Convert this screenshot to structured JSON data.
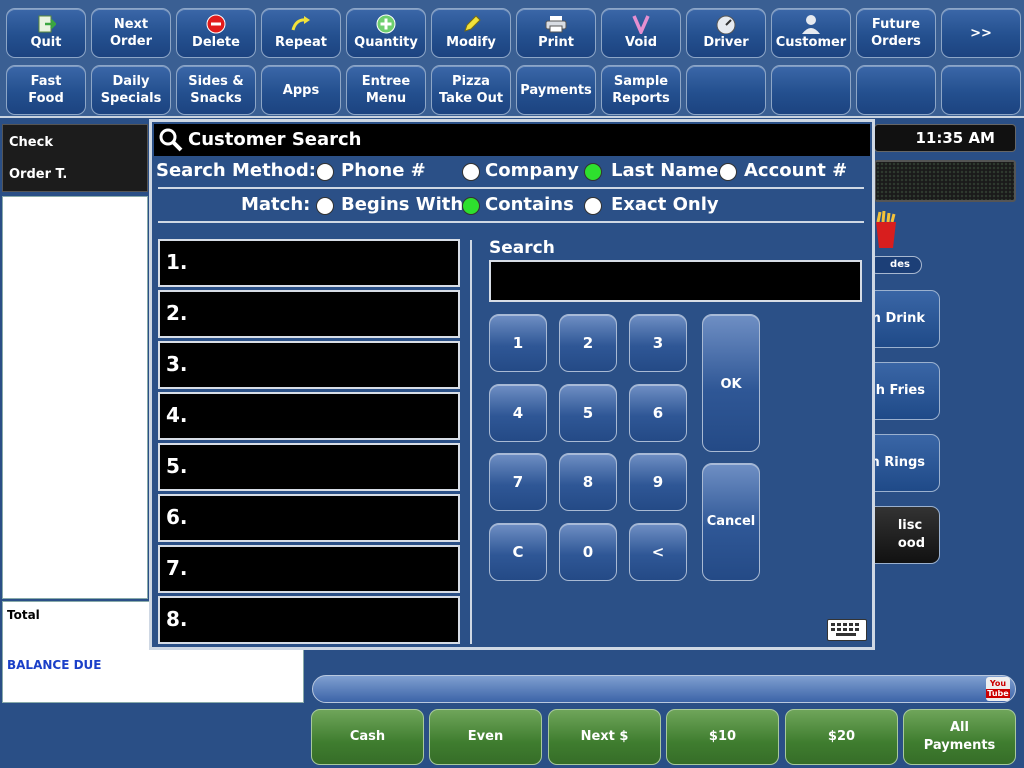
{
  "toolbar": {
    "row1": [
      {
        "label": "Quit",
        "icon": "quit-icon"
      },
      {
        "label": "Next\nOrder",
        "icon": ""
      },
      {
        "label": "Delete",
        "icon": "delete-icon"
      },
      {
        "label": "Repeat",
        "icon": "repeat-icon"
      },
      {
        "label": "Quantity",
        "icon": "quantity-icon"
      },
      {
        "label": "Modify",
        "icon": "modify-icon"
      },
      {
        "label": "Print",
        "icon": "print-icon"
      },
      {
        "label": "Void",
        "icon": "void-icon"
      },
      {
        "label": "Driver",
        "icon": "driver-icon"
      },
      {
        "label": "Customer",
        "icon": "customer-icon"
      },
      {
        "label": "Future\nOrders",
        "icon": ""
      },
      {
        "label": ">>",
        "icon": ""
      }
    ],
    "row2": [
      {
        "label": "Fast\nFood"
      },
      {
        "label": "Daily\nSpecials"
      },
      {
        "label": "Sides &\nSnacks"
      },
      {
        "label": "Apps"
      },
      {
        "label": "Entree\nMenu"
      },
      {
        "label": "Pizza\nTake Out"
      },
      {
        "label": "Payments"
      },
      {
        "label": "Sample\nReports"
      },
      {
        "label": ""
      },
      {
        "label": ""
      },
      {
        "label": ""
      },
      {
        "label": ""
      }
    ]
  },
  "check": {
    "check_label": "Check",
    "order_label": "Order T.",
    "total_label": "Total",
    "balance_label": "BALANCE DUE"
  },
  "right": {
    "clock": "11:35 AM",
    "sides_tab": "des",
    "buttons": [
      {
        "label": "in Drink"
      },
      {
        "label": "h Fries"
      },
      {
        "label": "n Rings"
      },
      {
        "label": "lisc\nood"
      }
    ]
  },
  "payments": [
    {
      "label": "Cash"
    },
    {
      "label": "Even"
    },
    {
      "label": "Next $"
    },
    {
      "label": "$10"
    },
    {
      "label": "$20"
    },
    {
      "label": "All\nPayments"
    }
  ],
  "youtube": {
    "line1": "You",
    "line2": "Tube"
  },
  "dialog": {
    "title": "Customer Search",
    "search_method_label": "Search Method:",
    "methods": [
      {
        "label": "Phone #",
        "selected": false
      },
      {
        "label": "Company",
        "selected": false
      },
      {
        "label": "Last Name",
        "selected": true
      },
      {
        "label": "Account #",
        "selected": false
      }
    ],
    "match_label": "Match:",
    "matches": [
      {
        "label": "Begins With",
        "selected": false
      },
      {
        "label": "Contains",
        "selected": true
      },
      {
        "label": "Exact Only",
        "selected": false
      }
    ],
    "results": [
      "1.",
      "2.",
      "3.",
      "4.",
      "5.",
      "6.",
      "7.",
      "8."
    ],
    "search_label": "Search",
    "search_value": "",
    "keys": [
      "1",
      "2",
      "3",
      "4",
      "5",
      "6",
      "7",
      "8",
      "9",
      "C",
      "0",
      "<"
    ],
    "ok_label": "OK",
    "cancel_label": "Cancel"
  }
}
